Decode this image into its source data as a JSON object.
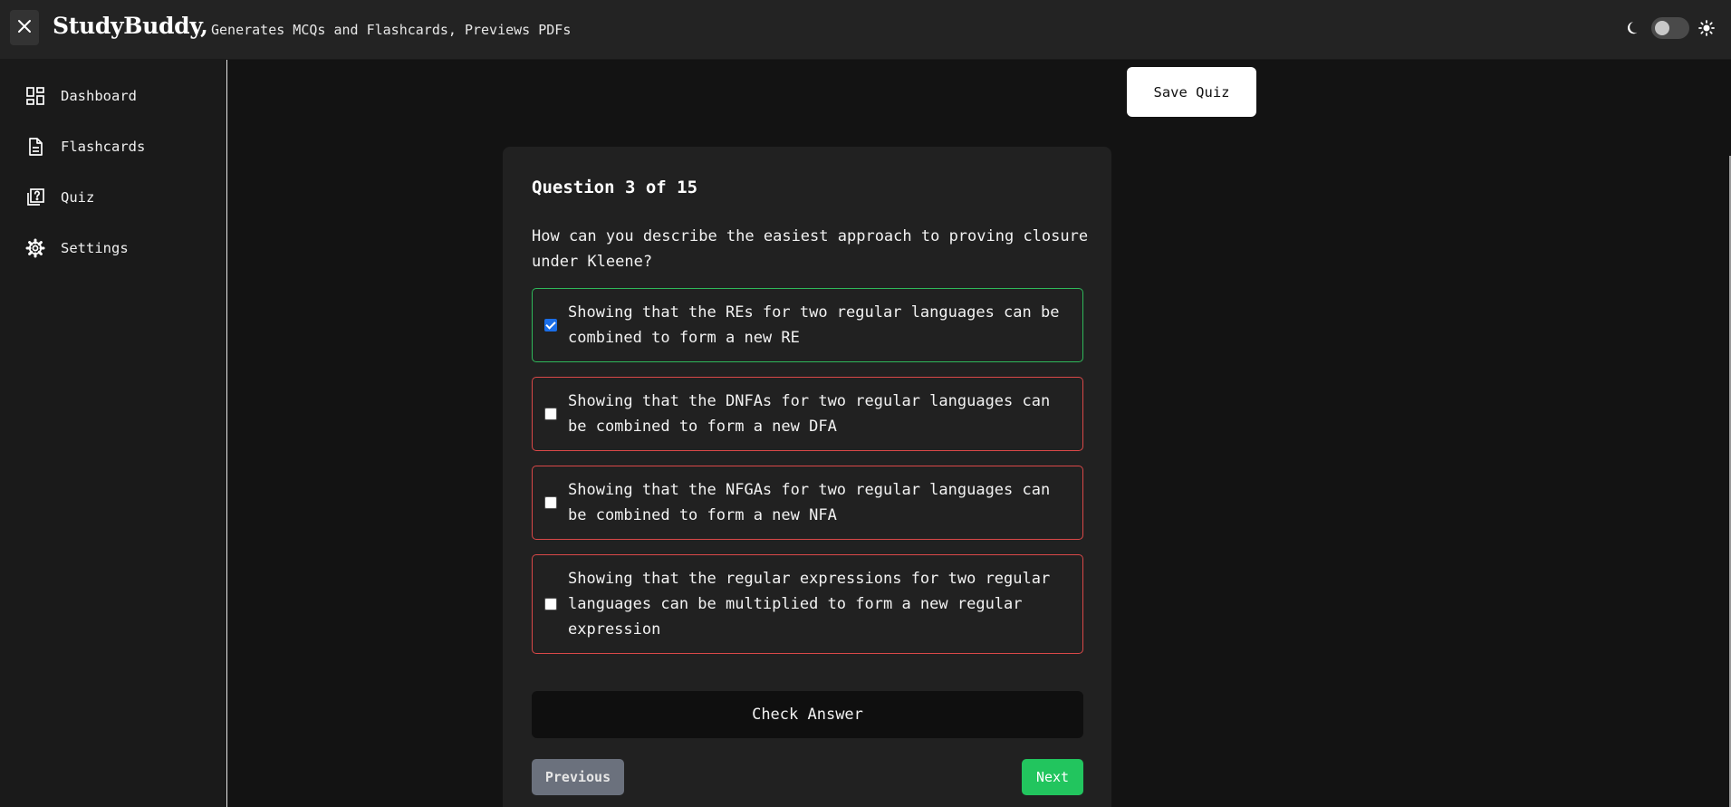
{
  "header": {
    "brand": "StudyBuddy,",
    "tagline": "Generates MCQs and Flashcards, Previews PDFs",
    "close_icon": "close-icon",
    "theme_icons": [
      "moon-icon",
      "sun-icon"
    ],
    "dark_mode_toggle_on": false
  },
  "sidebar": {
    "items": [
      {
        "label": "Dashboard",
        "icon": "dashboard-icon"
      },
      {
        "label": "Flashcards",
        "icon": "document-icon"
      },
      {
        "label": "Quiz",
        "icon": "quiz-icon"
      },
      {
        "label": "Settings",
        "icon": "gear-icon"
      }
    ]
  },
  "actions": {
    "save_quiz": "Save Quiz"
  },
  "quiz": {
    "counter": "Question 3 of 15",
    "question": "How can you describe the easiest approach to proving closure under Kleene?",
    "options": [
      {
        "text": "Showing that the REs for two regular languages can be combined to form a new RE",
        "checked": true,
        "status": "correct"
      },
      {
        "text": "Showing that the DNFAs for two regular languages can be combined to form a new DFA",
        "checked": false,
        "status": "incorrect"
      },
      {
        "text": "Showing that the NFGAs for two regular languages can be combined to form a new NFA",
        "checked": false,
        "status": "incorrect"
      },
      {
        "text": "Showing that the regular expressions for two regular languages can be multiplied to form a new regular expression",
        "checked": false,
        "status": "incorrect"
      }
    ],
    "check_answer": "Check Answer",
    "previous": "Previous",
    "next": "Next"
  },
  "colors": {
    "correct_border": "#2fb85a",
    "incorrect_border": "#d94848",
    "next_button": "#22c55e",
    "previous_button": "#6b717d",
    "checkbox_checked": "#1a6ee8"
  }
}
